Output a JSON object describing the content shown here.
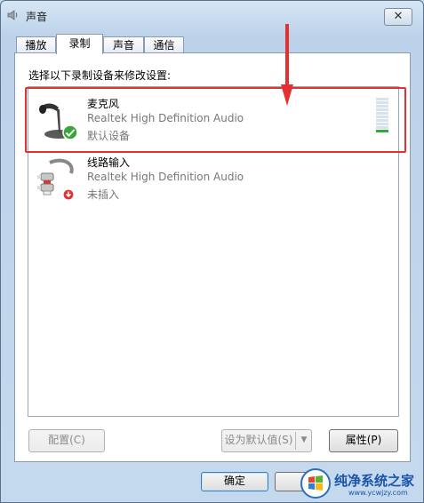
{
  "window": {
    "title": "声音",
    "close_glyph": "✕"
  },
  "tabs": [
    {
      "label": "播放"
    },
    {
      "label": "录制"
    },
    {
      "label": "声音"
    },
    {
      "label": "通信"
    }
  ],
  "instruction": "选择以下录制设备来修改设置:",
  "devices": [
    {
      "name": "麦克风",
      "driver": "Realtek High Definition Audio",
      "status": "默认设备",
      "icon": "microphone-icon",
      "badge": "default-check-icon",
      "level_fraction": 0.07
    },
    {
      "name": "线路输入",
      "driver": "Realtek High Definition Audio",
      "status": "未插入",
      "icon": "line-in-jack-icon",
      "badge": "unplugged-icon"
    }
  ],
  "buttons": {
    "configure": "配置(C)",
    "set_default": "设为默认值(S)",
    "properties": "属性(P)",
    "ok": "确定"
  },
  "watermark": {
    "name": "纯净系统之家",
    "url": "www.ycwjzy.com"
  },
  "colors": {
    "highlight": "#e5302f",
    "level_on": "#34a840",
    "check": "#3aa53a"
  }
}
